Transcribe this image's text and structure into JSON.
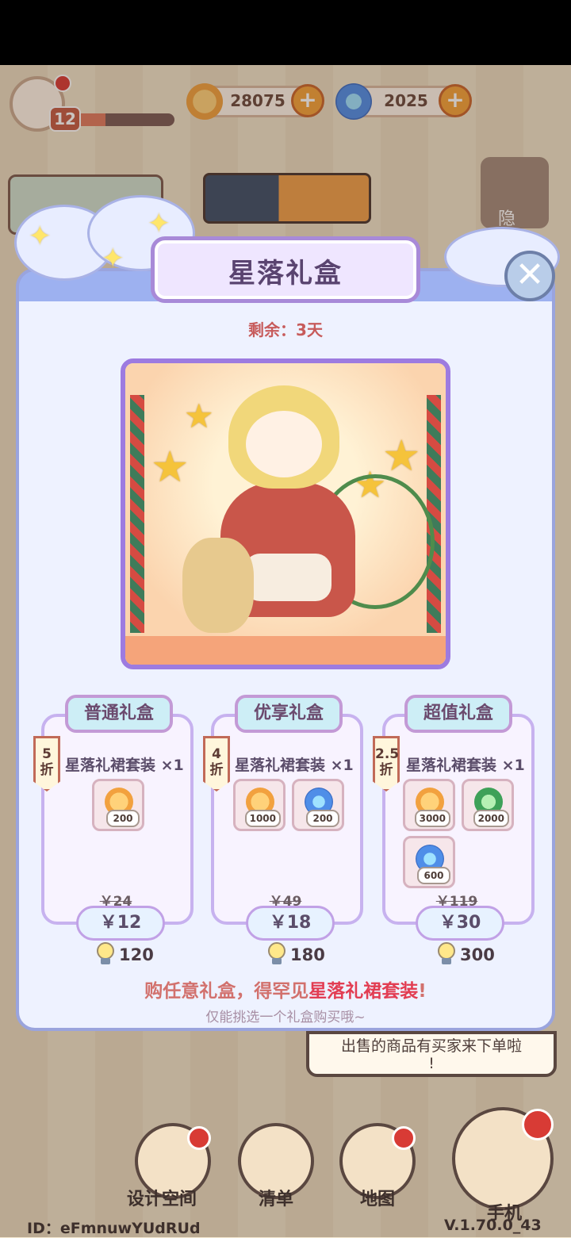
{
  "hud": {
    "level": "12",
    "xp_fraction": 0.3,
    "coins": "28075",
    "gems": "2025",
    "hide_label": "隐"
  },
  "dialog": {
    "title": "星落礼盒",
    "remaining": "剩余：3天",
    "cards": [
      {
        "name": "普通礼盒",
        "discount": "5\n折",
        "item": "星落礼裙套装 ×1",
        "rewards": [
          {
            "icon": "coin-icon",
            "qty": "200"
          }
        ],
        "original_price": "￥24",
        "price": "￥12",
        "bulbs": "120"
      },
      {
        "name": "优享礼盒",
        "discount": "4\n折",
        "item": "星落礼裙套装 ×1",
        "rewards": [
          {
            "icon": "coin-icon",
            "qty": "1000"
          },
          {
            "icon": "orb-icon",
            "qty": "200"
          }
        ],
        "original_price": "￥49",
        "price": "￥18",
        "bulbs": "180"
      },
      {
        "name": "超值礼盒",
        "discount": "2.5\n折",
        "item": "星落礼裙套装 ×1",
        "rewards": [
          {
            "icon": "coin-icon",
            "qty": "3000"
          },
          {
            "icon": "clover-icon",
            "qty": "2000"
          },
          {
            "icon": "orb-icon",
            "qty": "600"
          }
        ],
        "original_price": "￥119",
        "price": "￥30",
        "bulbs": "300"
      }
    ],
    "promo_prefix": "购任意礼盒，得罕见",
    "promo_highlight": "星落礼裙套装",
    "promo_suffix": "!",
    "note": "仅能挑选一个礼盒购买哦~"
  },
  "bottom": {
    "speech": "出售的商品有买家来下单啦\n!",
    "nav": [
      "设计空间",
      "清单",
      "地图",
      "手机"
    ],
    "user_id": "ID：eFmnuwYUdRUd",
    "version": "V.1.70.0_43"
  },
  "colors": {
    "accent": "#9d7be0",
    "price_red": "#e23d52",
    "panel": "#eef2ff"
  }
}
